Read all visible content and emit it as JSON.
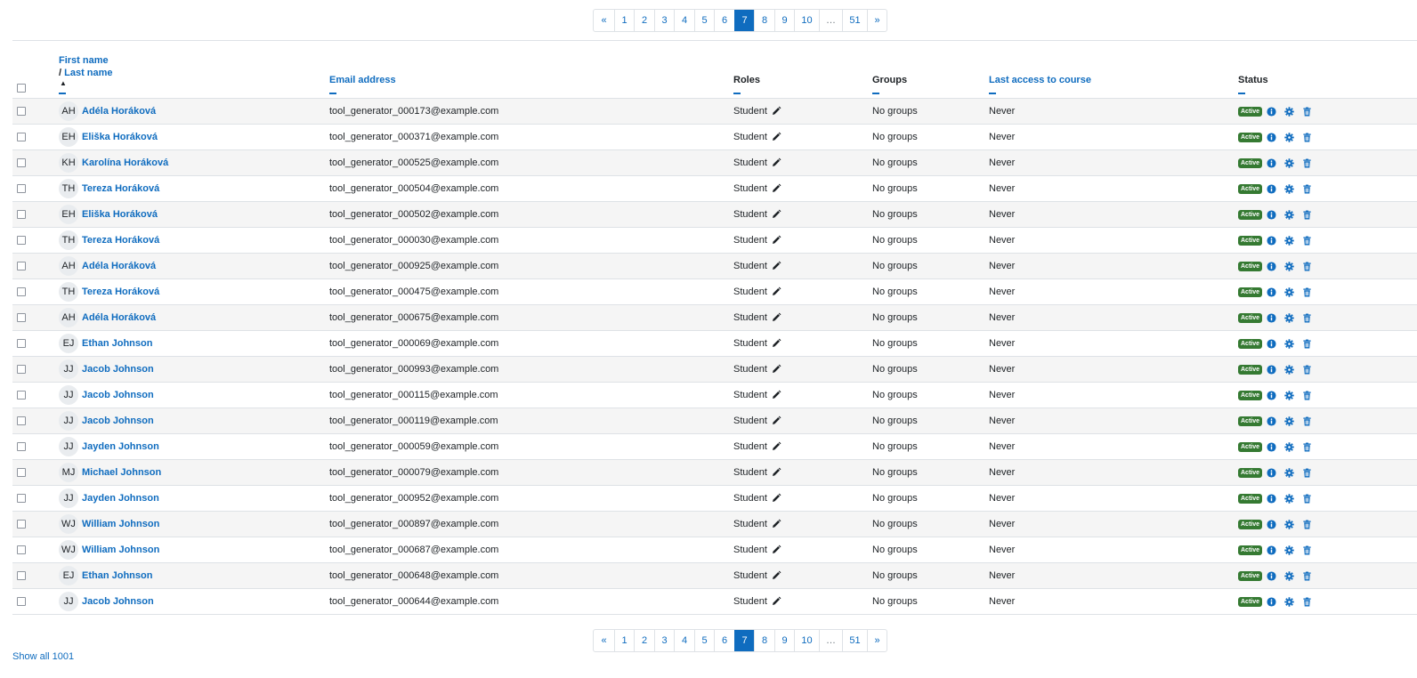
{
  "pagination": {
    "prev": "«",
    "next": "»",
    "pages": [
      "1",
      "2",
      "3",
      "4",
      "5",
      "6",
      "7",
      "8",
      "9",
      "10",
      "…",
      "51"
    ],
    "current": "7"
  },
  "table": {
    "headers": {
      "first_name": "First name",
      "slash": "/",
      "last_name": "Last name",
      "email": "Email address",
      "roles": "Roles",
      "groups": "Groups",
      "last_access": "Last access to course",
      "status": "Status"
    },
    "rows": [
      {
        "initials": "AH",
        "name": "Adéla Horáková",
        "email": "tool_generator_000173@example.com",
        "role": "Student",
        "groups": "No groups",
        "last_access": "Never",
        "status": "Active"
      },
      {
        "initials": "EH",
        "name": "Eliška Horáková",
        "email": "tool_generator_000371@example.com",
        "role": "Student",
        "groups": "No groups",
        "last_access": "Never",
        "status": "Active"
      },
      {
        "initials": "KH",
        "name": "Karolína Horáková",
        "email": "tool_generator_000525@example.com",
        "role": "Student",
        "groups": "No groups",
        "last_access": "Never",
        "status": "Active"
      },
      {
        "initials": "TH",
        "name": "Tereza Horáková",
        "email": "tool_generator_000504@example.com",
        "role": "Student",
        "groups": "No groups",
        "last_access": "Never",
        "status": "Active"
      },
      {
        "initials": "EH",
        "name": "Eliška Horáková",
        "email": "tool_generator_000502@example.com",
        "role": "Student",
        "groups": "No groups",
        "last_access": "Never",
        "status": "Active"
      },
      {
        "initials": "TH",
        "name": "Tereza Horáková",
        "email": "tool_generator_000030@example.com",
        "role": "Student",
        "groups": "No groups",
        "last_access": "Never",
        "status": "Active"
      },
      {
        "initials": "AH",
        "name": "Adéla Horáková",
        "email": "tool_generator_000925@example.com",
        "role": "Student",
        "groups": "No groups",
        "last_access": "Never",
        "status": "Active"
      },
      {
        "initials": "TH",
        "name": "Tereza Horáková",
        "email": "tool_generator_000475@example.com",
        "role": "Student",
        "groups": "No groups",
        "last_access": "Never",
        "status": "Active"
      },
      {
        "initials": "AH",
        "name": "Adéla Horáková",
        "email": "tool_generator_000675@example.com",
        "role": "Student",
        "groups": "No groups",
        "last_access": "Never",
        "status": "Active"
      },
      {
        "initials": "EJ",
        "name": "Ethan Johnson",
        "email": "tool_generator_000069@example.com",
        "role": "Student",
        "groups": "No groups",
        "last_access": "Never",
        "status": "Active"
      },
      {
        "initials": "JJ",
        "name": "Jacob Johnson",
        "email": "tool_generator_000993@example.com",
        "role": "Student",
        "groups": "No groups",
        "last_access": "Never",
        "status": "Active"
      },
      {
        "initials": "JJ",
        "name": "Jacob Johnson",
        "email": "tool_generator_000115@example.com",
        "role": "Student",
        "groups": "No groups",
        "last_access": "Never",
        "status": "Active"
      },
      {
        "initials": "JJ",
        "name": "Jacob Johnson",
        "email": "tool_generator_000119@example.com",
        "role": "Student",
        "groups": "No groups",
        "last_access": "Never",
        "status": "Active"
      },
      {
        "initials": "JJ",
        "name": "Jayden Johnson",
        "email": "tool_generator_000059@example.com",
        "role": "Student",
        "groups": "No groups",
        "last_access": "Never",
        "status": "Active"
      },
      {
        "initials": "MJ",
        "name": "Michael Johnson",
        "email": "tool_generator_000079@example.com",
        "role": "Student",
        "groups": "No groups",
        "last_access": "Never",
        "status": "Active"
      },
      {
        "initials": "JJ",
        "name": "Jayden Johnson",
        "email": "tool_generator_000952@example.com",
        "role": "Student",
        "groups": "No groups",
        "last_access": "Never",
        "status": "Active"
      },
      {
        "initials": "WJ",
        "name": "William Johnson",
        "email": "tool_generator_000897@example.com",
        "role": "Student",
        "groups": "No groups",
        "last_access": "Never",
        "status": "Active"
      },
      {
        "initials": "WJ",
        "name": "William Johnson",
        "email": "tool_generator_000687@example.com",
        "role": "Student",
        "groups": "No groups",
        "last_access": "Never",
        "status": "Active"
      },
      {
        "initials": "EJ",
        "name": "Ethan Johnson",
        "email": "tool_generator_000648@example.com",
        "role": "Student",
        "groups": "No groups",
        "last_access": "Never",
        "status": "Active"
      },
      {
        "initials": "JJ",
        "name": "Jacob Johnson",
        "email": "tool_generator_000644@example.com",
        "role": "Student",
        "groups": "No groups",
        "last_access": "Never",
        "status": "Active"
      }
    ]
  },
  "show_all": "Show all 1001",
  "colors": {
    "link": "#0f6cbf",
    "active_badge": "#357a32",
    "row_stripe": "#f5f5f5"
  },
  "icons": {
    "role_edit": "pencil-icon",
    "status_info": "info-icon",
    "status_settings": "gear-icon",
    "status_delete": "trash-icon"
  }
}
